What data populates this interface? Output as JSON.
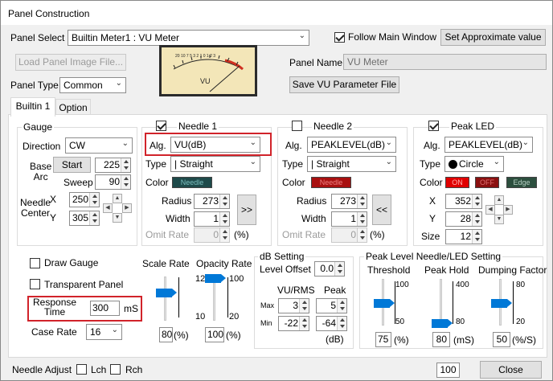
{
  "window": {
    "title": "Panel Construction"
  },
  "panel_select": {
    "label": "Panel Select",
    "value": "Builtin Meter1 : VU Meter"
  },
  "follow_main_window": {
    "label": "Follow Main Window",
    "checked": true
  },
  "set_approx_button": "Set Approximate value",
  "load_image_button": "Load Panel Image File...",
  "preview": {
    "vu_label": "VU"
  },
  "panel_name": {
    "label": "Panel Name",
    "value": "VU Meter"
  },
  "save_vu_button": "Save VU Parameter File",
  "panel_type": {
    "label": "Panel Type",
    "value": "Common"
  },
  "tabs": [
    {
      "label": "Builtin 1"
    },
    {
      "label": "Option"
    }
  ],
  "gauge": {
    "title": "Gauge",
    "direction_label": "Direction",
    "direction_value": "CW",
    "base_arc_label": "Base\nArc",
    "start_button": "Start",
    "start_value": "225",
    "sweep_label": "Sweep",
    "sweep_value": "90",
    "needle_center_label": "Needle\nCenter",
    "x_label": "X",
    "x_value": "250",
    "y_label": "Y",
    "y_value": "305"
  },
  "needle1": {
    "title": "Needle 1",
    "checked": true,
    "alg_label": "Alg.",
    "alg_value": "VU(dB)",
    "type_label": "Type",
    "type_value": "| Straight",
    "color_label": "Color",
    "color_swatch": "Needle",
    "radius_label": "Radius",
    "radius_value": "273",
    "width_label": "Width",
    "width_value": "1",
    "omit_label": "Omit Rate",
    "omit_value": "0",
    "omit_unit": "(%)",
    "copy_button": ">>"
  },
  "needle2": {
    "title": "Needle 2",
    "checked": false,
    "alg_label": "Alg.",
    "alg_value": "PEAKLEVEL(dB)",
    "type_label": "Type",
    "type_value": "| Straight",
    "color_label": "Color",
    "color_swatch": "Needle",
    "radius_label": "Radius",
    "radius_value": "273",
    "width_label": "Width",
    "width_value": "1",
    "omit_label": "Omit Rate",
    "omit_value": "0",
    "omit_unit": "(%)",
    "copy_button": "<<"
  },
  "peak_led": {
    "title": "Peak LED",
    "checked": true,
    "alg_label": "Alg.",
    "alg_value": "PEAKLEVEL(dB)",
    "type_label": "Type",
    "type_value": "Circle",
    "color_label": "Color",
    "on_swatch": "ON",
    "off_swatch": "OFF",
    "edge_swatch": "Edge",
    "x_label": "X",
    "x_value": "352",
    "y_label": "Y",
    "y_value": "28",
    "size_label": "Size",
    "size_value": "12"
  },
  "draw_gauge": {
    "label": "Draw Gauge",
    "checked": false
  },
  "transparent_panel": {
    "label": "Transparent Panel",
    "checked": false
  },
  "response_time": {
    "label": "Response\nTime",
    "value": "300",
    "unit": "mS"
  },
  "case_rate": {
    "label": "Case Rate",
    "value": "16"
  },
  "scale_rate": {
    "title": "Scale Rate",
    "max_label": "120",
    "min_label": "10",
    "value": "80",
    "unit": "(%)",
    "level": 0.64
  },
  "opacity_rate": {
    "title": "Opacity Rate",
    "max_label": "100",
    "min_label": "20",
    "value": "100",
    "unit": "(%)",
    "level": 1.0
  },
  "db_setting": {
    "title": "dB Setting",
    "level_offset_label": "Level Offset",
    "level_offset_value": "0.0",
    "vu_rms_label": "VU/RMS",
    "peak_label": "Peak",
    "max_label": "Max",
    "min_label": "Min",
    "vu_max": "3",
    "peak_max": "5",
    "vu_min": "-22",
    "peak_min": "-64",
    "unit": "(dB)"
  },
  "peak_needle": {
    "title": "Peak Level Needle/LED Setting",
    "threshold": {
      "title": "Threshold",
      "max_label": "100",
      "min_label": "50",
      "value": "75",
      "unit": "(%)",
      "level": 0.5
    },
    "peak_hold": {
      "title": "Peak Hold",
      "max_label": "400",
      "min_label": "80",
      "value": "80",
      "unit": "(mS)",
      "level": 0.0
    },
    "dumping": {
      "title": "Dumping Factor",
      "max_label": "80",
      "min_label": "20",
      "value": "50",
      "unit": "(%/S)",
      "level": 0.5
    }
  },
  "needle_adjust": {
    "label": "Needle Adjust",
    "lch_label": "Lch",
    "rch_label": "Rch"
  },
  "status_value": "100",
  "close_button": "Close",
  "colors": {
    "accent": "#0078d7",
    "highlight": "#d1232a",
    "needle_swatch": "#1e4a4a",
    "needle2_swatch": "#a81010",
    "led_on": "#e00000",
    "led_off": "#8a1010"
  }
}
